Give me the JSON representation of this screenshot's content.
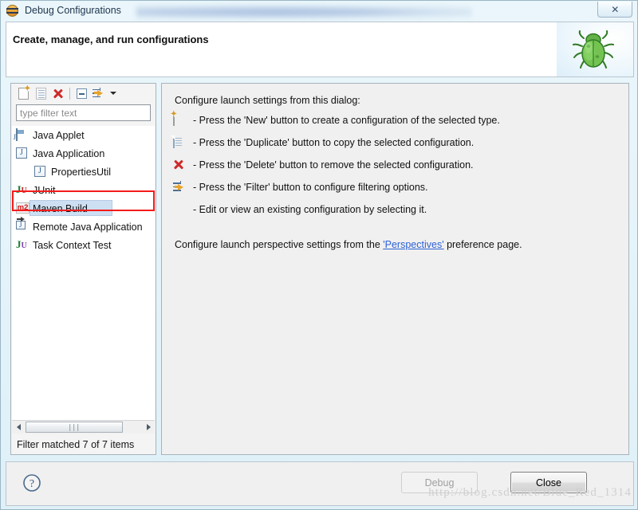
{
  "window": {
    "title": "Debug Configurations",
    "title_icon": "debug-circle-icon",
    "close_glyph": "✕"
  },
  "header": {
    "title": "Create, manage, and run configurations",
    "icon": "green-bug-icon"
  },
  "left_panel": {
    "toolbar": [
      {
        "name": "new-configuration-button",
        "icon": "new-page-icon",
        "enabled": true
      },
      {
        "name": "duplicate-configuration-button",
        "icon": "duplicate-page-icon",
        "enabled": false
      },
      {
        "name": "delete-configuration-button",
        "icon": "delete-x-icon",
        "enabled": true
      },
      {
        "name": "collapse-all-button",
        "icon": "collapse-all-icon",
        "enabled": true
      },
      {
        "name": "filter-button",
        "icon": "filter-icon",
        "enabled": true
      },
      {
        "name": "filter-dropdown-button",
        "icon": "chevron-down-icon",
        "enabled": true
      }
    ],
    "filter": {
      "value": "",
      "placeholder": "type filter text"
    },
    "tree": [
      {
        "label": "Java Applet",
        "icon": "java-applet-icon",
        "indent": 0,
        "selected": false
      },
      {
        "label": "Java Application",
        "icon": "java-application-icon",
        "indent": 0,
        "selected": false
      },
      {
        "label": "PropertiesUtil",
        "icon": "java-application-icon",
        "indent": 1,
        "selected": false
      },
      {
        "label": "JUnit",
        "icon": "junit-icon",
        "indent": 0,
        "selected": false
      },
      {
        "label": "Maven Build",
        "icon": "maven-m2-icon",
        "indent": 0,
        "selected": true
      },
      {
        "label": "Remote Java Application",
        "icon": "remote-java-application-icon",
        "indent": 0,
        "selected": false
      },
      {
        "label": "Task Context Test",
        "icon": "task-context-test-icon",
        "indent": 0,
        "selected": false
      }
    ],
    "scrollbar": {
      "left_arrow": "scroll-left-arrow",
      "right_arrow": "scroll-right-arrow",
      "thumb_grip": "∣∣∣"
    },
    "status": "Filter matched 7 of 7 items"
  },
  "right_panel": {
    "intro": "Configure launch settings from this dialog:",
    "bullets": [
      {
        "icon": "new-page-icon",
        "text": "- Press the 'New' button to create a configuration of the selected type."
      },
      {
        "icon": "duplicate-page-icon",
        "text": "- Press the 'Duplicate' button to copy the selected configuration."
      },
      {
        "icon": "delete-x-icon",
        "text": "- Press the 'Delete' button to remove the selected configuration."
      },
      {
        "icon": "filter-icon",
        "text": "- Press the 'Filter' button to configure filtering options."
      },
      {
        "icon": "none",
        "text": "- Edit or view an existing configuration by selecting it."
      }
    ],
    "perspectives": {
      "prefix": "Configure launch perspective settings from the ",
      "link": "'Perspectives'",
      "suffix": " preference page."
    }
  },
  "footer": {
    "help_button": "?",
    "debug_button": "Debug",
    "close_button": "Close",
    "watermark": "http://blog.csdn.net/Blue_Red_1314"
  },
  "colors": {
    "accent_link": "#2d61d8",
    "selection": "#cddff2",
    "annotation": "#f41b1b",
    "delete_red": "#cf2a2a",
    "maven_red": "#d01616"
  }
}
